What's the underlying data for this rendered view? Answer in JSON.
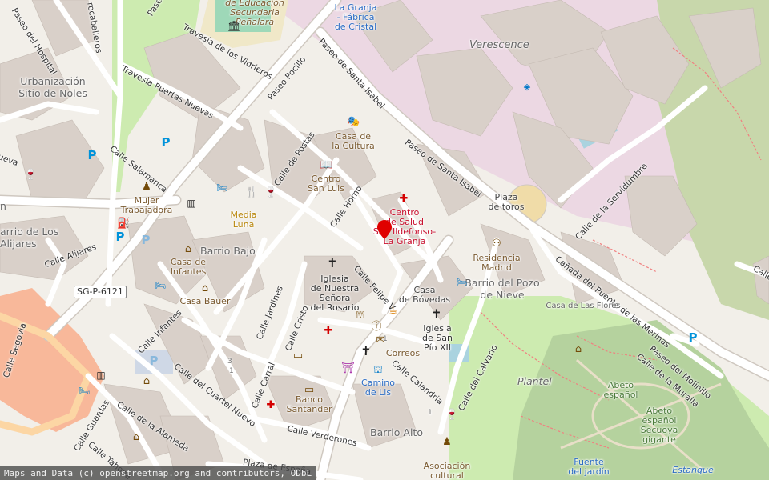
{
  "map": {
    "attribution": "Maps and Data (c) openstreetmap.org and contributors, ODbL",
    "colors": {
      "background": "#f2efe9",
      "building": "#d9d0c9",
      "road": "#ffffff",
      "road_casing": "#cfc8c0",
      "park": "#cdebb0",
      "forest": "#add19e",
      "residential": "#e0dfdf",
      "retail": "#f2dad9",
      "primary": "#fcd6a4",
      "water": "#aad3df"
    },
    "marker": {
      "color": "#e00000",
      "name": "location-marker"
    },
    "streets": [
      "Paseo del Hospital",
      "recaballeros",
      "Paseo",
      "Travesía de los Vidrieros",
      "Paseo Pocillo",
      "Travesía Puertas Nuevas",
      "Paseo de Santa Isabel",
      "Paseo de Santa Isabel",
      "Calle Salamanca",
      "Calle de Postas",
      "Calle Horno",
      "Calle de la Servidumbre",
      "Calle Alijares",
      "Calle Felipe V",
      "Cañada del Puente de las Merinas",
      "Calle Infantes",
      "Calle Jardines",
      "Calle Cristo",
      "Calle del Calvario",
      "Paseo del Molinillo",
      "Calle de la Muralla",
      "Calle del Cuartel Nuevo",
      "Calle Carral",
      "Calle Calandria",
      "Calle de la Alameda",
      "Calle Guardas",
      "Calle Verderones",
      "Calle Tahona",
      "Plaza de España",
      "Calle Segovia",
      "ueva",
      "Calle"
    ],
    "road_shield": "SG-P-6121",
    "places": {
      "verescence": "Verescence",
      "urbanizacion": [
        "Urbanización",
        "Sitio de Noles"
      ],
      "barrio_de_los": [
        "arrio de Los",
        "Alijares"
      ],
      "barrio_bajo": "Barrio Bajo",
      "barrio_pozo": [
        "Barrio del Pozo",
        "de Nieve"
      ],
      "barrio_alto": "Barrio Alto",
      "plantel": "Plantel",
      "n_label": "n"
    },
    "pois": {
      "granja": [
        "La Granja",
        "- Fábrica",
        "de Cristal"
      ],
      "educacion": [
        "de Educación",
        "Secundaria",
        "Peñalara"
      ],
      "casa_cultura": [
        "Casa de",
        "la Cultura"
      ],
      "centro_san_luis": [
        "Centro",
        "San Luis"
      ],
      "centro_salud": [
        "Centro",
        "de Salud",
        "San Ildefonso-",
        "La Granja"
      ],
      "plaza_toros": [
        "Plaza",
        "de toros"
      ],
      "mujer_trabajadora": [
        "Mujer",
        "Trabajadora"
      ],
      "media_luna": [
        "Media",
        "Luna"
      ],
      "casa_infantes": [
        "Casa de",
        "Infantes"
      ],
      "casa_bauer": "Casa Bauer",
      "iglesia_rosario": [
        "Iglesia",
        "de Nuestra",
        "Señora",
        "del Rosario"
      ],
      "casa_bovedas": [
        "Casa",
        "de Bóvedas"
      ],
      "residencia": [
        "Residencia",
        "Madrid"
      ],
      "casa_flores": "Casa de Las Flores",
      "iglesia_pio": [
        "Iglesia",
        "de San",
        "Pío XII"
      ],
      "correos": "Correos",
      "camino_lis": [
        "Camino",
        "de Lis"
      ],
      "banco": [
        "Banco",
        "Santander"
      ],
      "asociacion": [
        "Asociación",
        "cultural"
      ],
      "abeto1": [
        "Abeto",
        "español"
      ],
      "abeto2": [
        "Abeto",
        "español",
        "Secuoya",
        "gigante"
      ],
      "fuente": [
        "Fuente",
        "del jardín"
      ],
      "estanque": "Estanque"
    },
    "house_numbers": [
      "3",
      "1",
      "1",
      "1"
    ]
  }
}
